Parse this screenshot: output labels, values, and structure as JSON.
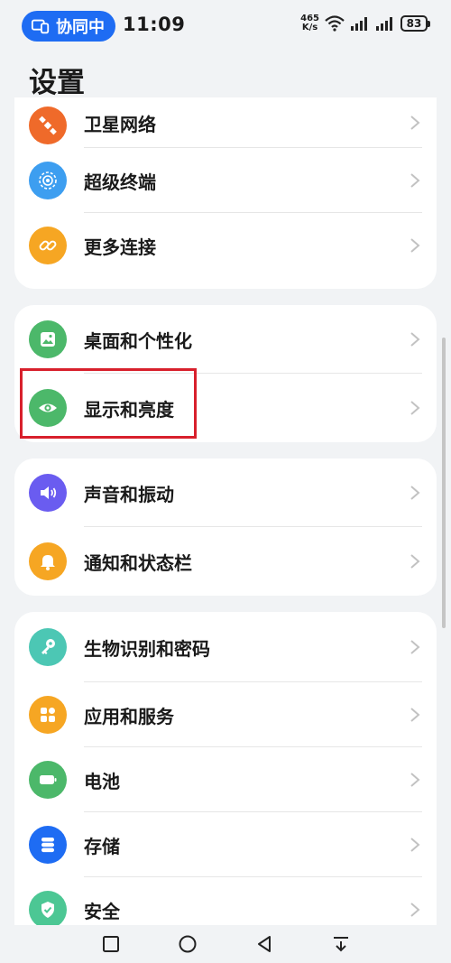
{
  "status": {
    "collab_label": "协同中",
    "time": "11:09",
    "net_speed": "465",
    "net_unit": "K/s",
    "battery": "83"
  },
  "page": {
    "title": "设置"
  },
  "groups": [
    {
      "items": [
        {
          "label": "卫星网络",
          "icon": "satellite-icon",
          "color": "#ef6a2a"
        },
        {
          "label": "超级终端",
          "icon": "super-device-icon",
          "color": "#3d9ef0"
        },
        {
          "label": "更多连接",
          "icon": "link-icon",
          "color": "#f6a623"
        }
      ]
    },
    {
      "items": [
        {
          "label": "桌面和个性化",
          "icon": "wallpaper-icon",
          "color": "#4cb86a"
        },
        {
          "label": "显示和亮度",
          "icon": "eye-icon",
          "color": "#4cb86a"
        }
      ]
    },
    {
      "items": [
        {
          "label": "声音和振动",
          "icon": "speaker-icon",
          "color": "#6a5cf0"
        },
        {
          "label": "通知和状态栏",
          "icon": "bell-icon",
          "color": "#f6a623"
        }
      ]
    },
    {
      "items": [
        {
          "label": "生物识别和密码",
          "icon": "key-icon",
          "color": "#4cc7b4"
        },
        {
          "label": "应用和服务",
          "icon": "apps-icon",
          "color": "#f6a623"
        },
        {
          "label": "电池",
          "icon": "battery-icon",
          "color": "#4cb86a"
        },
        {
          "label": "存储",
          "icon": "storage-icon",
          "color": "#1e6cf3"
        },
        {
          "label": "安全",
          "icon": "shield-icon",
          "color": "#4cc794"
        }
      ]
    }
  ]
}
